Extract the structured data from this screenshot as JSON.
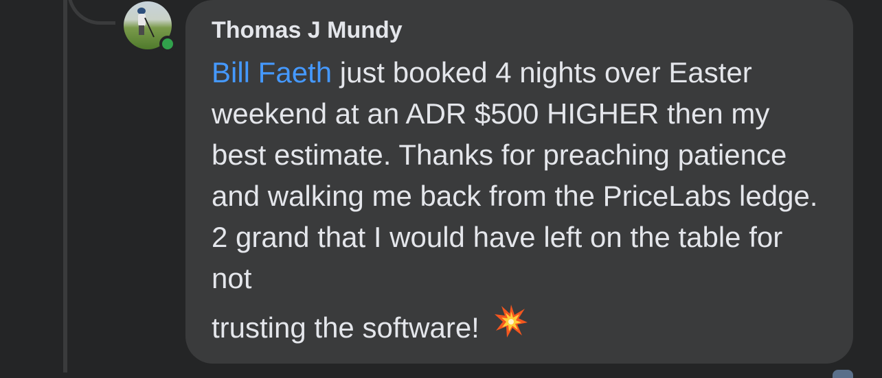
{
  "comment": {
    "author": "Thomas J Mundy",
    "mention": "Bill Faeth",
    "body": " just booked 4 nights over Easter weekend at an ADR $500 HIGHER then my best estimate.    Thanks for preaching patience and walking me back from the PriceLabs ledge.    2 grand that I would have left on the table for not",
    "last_line": "trusting the software!",
    "emoji_icon": "collision-icon",
    "avatar_online": true
  },
  "colors": {
    "background": "#242526",
    "bubble": "#3a3b3c",
    "text": "#e4e6eb",
    "mention": "#4599ff",
    "online": "#31a24c"
  }
}
